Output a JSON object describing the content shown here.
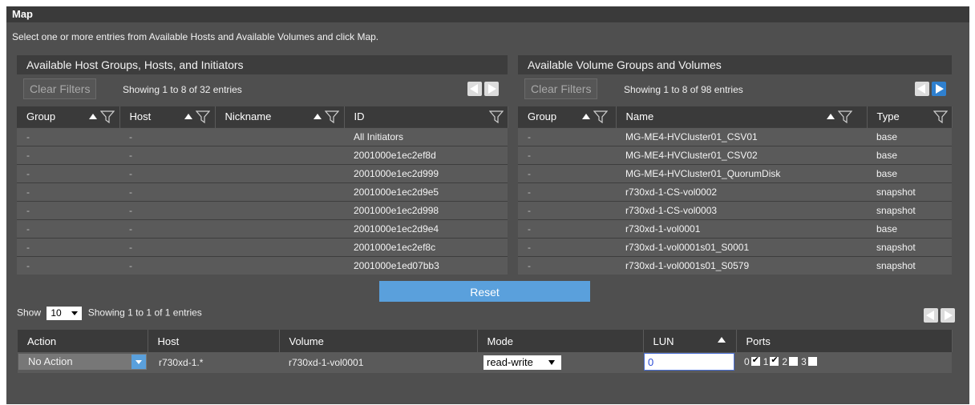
{
  "window": {
    "title": "Map"
  },
  "instructions": "Select one or more entries from Available Hosts and Available Volumes and click Map.",
  "hosts_panel": {
    "title": "Available Host Groups, Hosts, and Initiators",
    "clear_filters": "Clear Filters",
    "showing": "Showing 1 to 8 of 32 entries",
    "columns": [
      "Group",
      "Host",
      "Nickname",
      "ID"
    ],
    "rows": [
      [
        "-",
        "-",
        "",
        "All Initiators"
      ],
      [
        "-",
        "-",
        "",
        "2001000e1ec2ef8d"
      ],
      [
        "-",
        "-",
        "",
        "2001000e1ec2d999"
      ],
      [
        "-",
        "-",
        "",
        "2001000e1ec2d9e5"
      ],
      [
        "-",
        "-",
        "",
        "2001000e1ec2d998"
      ],
      [
        "-",
        "-",
        "",
        "2001000e1ec2d9e4"
      ],
      [
        "-",
        "-",
        "",
        "2001000e1ec2ef8c"
      ],
      [
        "-",
        "-",
        "",
        "2001000e1ed07bb3"
      ]
    ]
  },
  "volumes_panel": {
    "title": "Available Volume Groups and Volumes",
    "clear_filters": "Clear Filters",
    "showing": "Showing 1 to 8 of 98 entries",
    "columns": [
      "Group",
      "Name",
      "Type"
    ],
    "rows": [
      [
        "-",
        "MG-ME4-HVCluster01_CSV01",
        "base"
      ],
      [
        "-",
        "MG-ME4-HVCluster01_CSV02",
        "base"
      ],
      [
        "-",
        "MG-ME4-HVCluster01_QuorumDisk",
        "base"
      ],
      [
        "-",
        "r730xd-1-CS-vol0002",
        "snapshot"
      ],
      [
        "-",
        "r730xd-1-CS-vol0003",
        "snapshot"
      ],
      [
        "-",
        "r730xd-1-vol0001",
        "base"
      ],
      [
        "-",
        "r730xd-1-vol0001s01_S0001",
        "snapshot"
      ],
      [
        "-",
        "r730xd-1-vol0001s01_S0579",
        "snapshot"
      ]
    ]
  },
  "reset_label": "Reset",
  "mapping": {
    "show_label": "Show",
    "page_size": "10",
    "showing": "Showing 1 to 1 of 1 entries",
    "columns": [
      "Action",
      "Host",
      "Volume",
      "Mode",
      "LUN",
      "Ports"
    ],
    "row": {
      "action": "No Action",
      "host": "r730xd-1.*",
      "volume": "r730xd-1-vol0001",
      "mode": "read-write",
      "lun": "0",
      "ports": [
        {
          "label": "0",
          "checked": true
        },
        {
          "label": "1",
          "checked": true
        },
        {
          "label": "2",
          "checked": false
        },
        {
          "label": "3",
          "checked": false
        }
      ]
    }
  },
  "colors": {
    "background": "#4f4f4f",
    "header": "#3a3a3a",
    "accent": "#5aa0dc",
    "row": "#5a5a5a"
  }
}
